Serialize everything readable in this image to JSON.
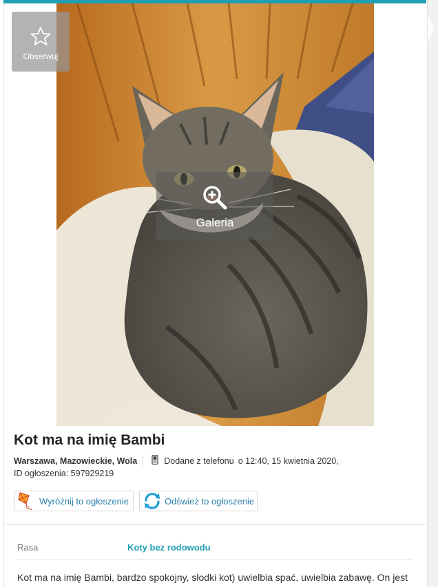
{
  "actions": {
    "observe_label": "Obserwuj",
    "gallery_label": "Galeria"
  },
  "listing": {
    "title": "Kot ma na imię Bambi",
    "location": "Warszawa, Mazowieckie, Wola",
    "added_via": "Dodane z telefonu",
    "added_at": "o 12:40, 15 kwietnia 2020,",
    "ad_id": "ID ogłoszenia: 597929219"
  },
  "buttons": {
    "promote_label": "Wyróżnij to ogłoszenie",
    "refresh_label": "Odśwież to ogłoszenie"
  },
  "attributes": [
    {
      "label": "Rasa",
      "value": "Koty bez rodowodu"
    }
  ],
  "description": "Kot ma na imię Bambi, bardzo spokojny, słodki kot) uwielbia spać, uwielbia zabawę. On jest",
  "colors": {
    "accent": "#1f9fb3",
    "link": "#2a7fae"
  },
  "icons": [
    "star-icon",
    "zoom-in-icon",
    "phone-icon",
    "kite-icon",
    "refresh-icon"
  ]
}
